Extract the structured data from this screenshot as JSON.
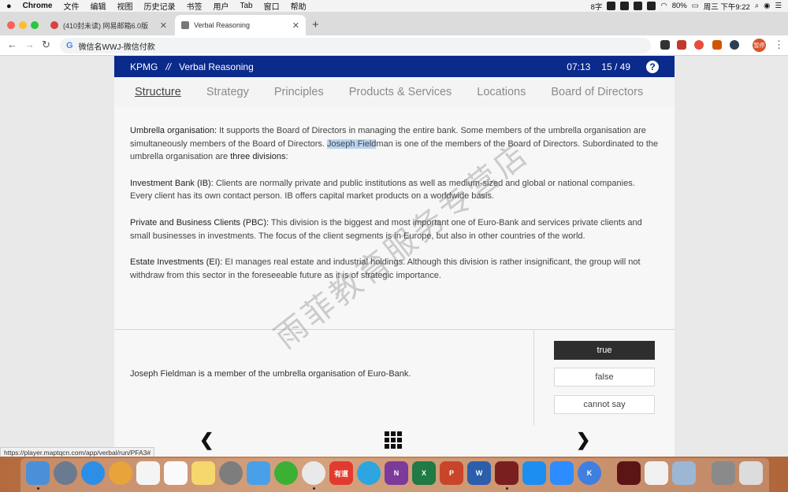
{
  "menubar": {
    "apple": "",
    "items": [
      "Chrome",
      "文件",
      "编辑",
      "视图",
      "历史记录",
      "书签",
      "用户",
      "Tab",
      "窗口",
      "帮助"
    ],
    "status": {
      "battery": "80%",
      "clock": "周三 下午9:22",
      "ime": "8字"
    }
  },
  "tabs": [
    {
      "title": "(410封未读) 网易邮箱6.0版"
    },
    {
      "title": "Verbal Reasoning"
    }
  ],
  "new_tab": "+",
  "toolbar": {
    "address": "微信名WWJ-微信付款",
    "profile": "暂停"
  },
  "header": {
    "brand": "KPMG",
    "separator": "//",
    "section": "Verbal Reasoning",
    "timer": "07:13",
    "counter": "15 / 49",
    "help": "?"
  },
  "subnav": [
    "Structure",
    "Strategy",
    "Principles",
    "Products & Services",
    "Locations",
    "Board of Directors"
  ],
  "passage": {
    "p1": {
      "lead": "Umbrella organisation:",
      "a": " It supports the Board of Directors in managing the entire bank. Some members of the umbrella organisation are simultaneously members of the Board of Directors. ",
      "highlight": "Joseph Field",
      "b": "man is one of the members of the Board of Directors. Subordinated to the umbrella organisation are ",
      "strong": "three divisions:"
    },
    "p2": {
      "lead": "Investment Bank (IB):",
      "text": " Clients are normally private and public institutions as well as medium-sized and global or national companies. Every client has its own contact person. IB offers capital market products on a worldwide basis."
    },
    "p3": {
      "lead": "Private and Business Clients (PBC):",
      "text": " This division is the biggest and most important one of Euro-Bank and services private clients and small businesses in investments. The focus of the client segments is in Europe, but also in other countries of the world."
    },
    "p4": {
      "lead": "Estate Investments (EI):",
      "text": " EI manages real estate and industrial holdings. Although this division is rather insignificant, the group will not withdraw from this sector in the foreseeable future as it is of strategic importance."
    }
  },
  "question": {
    "statement": "Joseph Fieldman is a member of the umbrella organisation of Euro-Bank.",
    "options": [
      "true",
      "false",
      "cannot say"
    ],
    "selected": "true"
  },
  "status_url": "https://player.maptqcn.com/app/verbal/run/PFA3#",
  "watermark": "雨菲教育服务专营店",
  "dock_labels": [
    "有道",
    "N",
    "X",
    "P",
    "W",
    "K"
  ]
}
